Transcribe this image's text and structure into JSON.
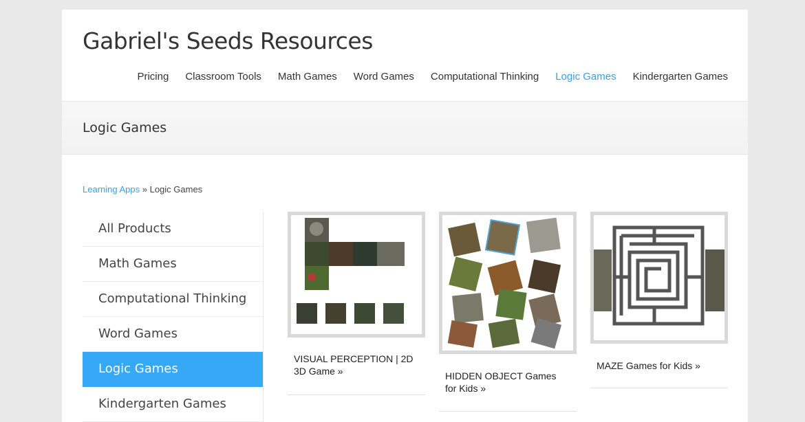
{
  "site": {
    "title": "Gabriel's Seeds Resources"
  },
  "nav": {
    "items": [
      "Pricing",
      "Classroom Tools",
      "Math Games",
      "Word Games",
      "Computational Thinking",
      "Logic Games",
      "Kindergarten Games"
    ],
    "active": "Logic Games"
  },
  "page": {
    "title": "Logic Games"
  },
  "breadcrumb": {
    "parent": "Learning Apps",
    "separator": "»",
    "current": "Logic Games"
  },
  "sidebar": {
    "items": [
      {
        "label": "All Products"
      },
      {
        "label": "Math Games"
      },
      {
        "label": "Computational Thinking"
      },
      {
        "label": "Word Games"
      },
      {
        "label": "Logic Games",
        "active": true
      },
      {
        "label": "Kindergarten Games"
      }
    ]
  },
  "products": [
    {
      "title": "VISUAL PERCEPTION | 2D 3D Game »"
    },
    {
      "title": "HIDDEN OBJECT Games for Kids »"
    },
    {
      "title": "MAZE Games for Kids »"
    }
  ],
  "colors": {
    "accent": "#36a1e6",
    "active_bg": "#36a8f5",
    "page_bg": "#e9e9e9"
  }
}
